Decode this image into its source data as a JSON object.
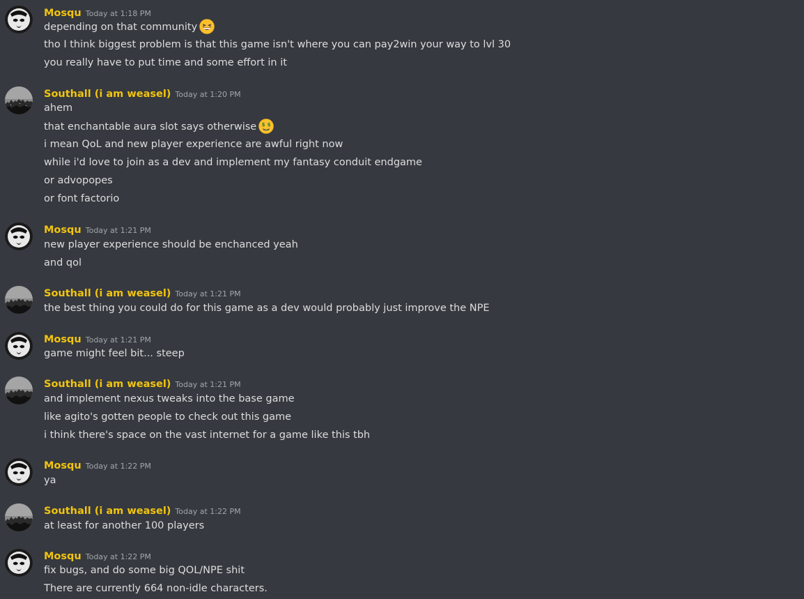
{
  "users": {
    "mosqu": {
      "name": "Mosqu",
      "color": "#f1c40f"
    },
    "southall": {
      "name": "Southall (i am weasel)",
      "color": "#f1c40f"
    }
  },
  "messages": [
    {
      "author": "Mosqu",
      "timestamp": "Today at 1:18 PM",
      "lines": [
        "depending on that community",
        "tho I think biggest problem is that this game isn't where you can pay2win your way to lvl 30",
        "you really have to put time and some effort in it"
      ],
      "emoji": "grinning-squint-emoji"
    },
    {
      "author": "Southall (i am weasel)",
      "timestamp": "Today at 1:20 PM",
      "lines": [
        "ahem",
        "that enchantable aura slot says otherwise",
        "i mean QoL and new player experience are awful right now",
        "while i'd love to join as a dev and implement my fantasy conduit endgame",
        "or advopopes",
        "or font factorio"
      ],
      "emoji": "money-mouth-emoji"
    },
    {
      "author": "Mosqu",
      "timestamp": "Today at 1:21 PM",
      "lines": [
        "new player experience should be enchanced yeah",
        "and qol"
      ]
    },
    {
      "author": "Southall (i am weasel)",
      "timestamp": "Today at 1:21 PM",
      "lines": [
        "the best thing you could do for this game as a dev would probably just improve the NPE"
      ]
    },
    {
      "author": "Mosqu",
      "timestamp": "Today at 1:21 PM",
      "lines": [
        "game might feel bit... steep"
      ]
    },
    {
      "author": "Southall (i am weasel)",
      "timestamp": "Today at 1:21 PM",
      "lines": [
        "and implement nexus tweaks into the base game",
        "like agito's gotten people to check out this game",
        "i think there's space on the vast internet for a game like this tbh"
      ]
    },
    {
      "author": "Mosqu",
      "timestamp": "Today at 1:22 PM",
      "lines": [
        "ya"
      ]
    },
    {
      "author": "Southall (i am weasel)",
      "timestamp": "Today at 1:22 PM",
      "lines": [
        "at least for another 100 players"
      ]
    },
    {
      "author": "Mosqu",
      "timestamp": "Today at 1:22 PM",
      "lines": [
        "fix bugs, and do some big QOL/NPE shit",
        "There are currently 664 non-idle characters."
      ]
    }
  ]
}
